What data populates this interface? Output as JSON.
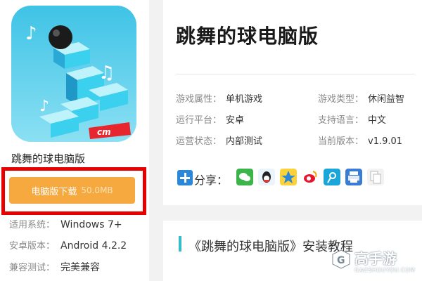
{
  "app": {
    "name": "跳舞的球电脑版",
    "icon_label": "dancing-ball-app-icon",
    "publisher_badge": "cm"
  },
  "download": {
    "label": "电脑版下载",
    "size": "50.0MB"
  },
  "specs": [
    {
      "label": "适用系统：",
      "value": "Windows 7+"
    },
    {
      "label": "安卓版本：",
      "value": "Android 4.2.2"
    },
    {
      "label": "兼容测试：",
      "value": "完美兼容"
    }
  ],
  "header": {
    "title": "跳舞的球电脑版"
  },
  "info": {
    "attr_label": "游戏属性：",
    "attr_value": "单机游戏",
    "type_label": "游戏类型：",
    "type_value": "休闲益智",
    "platform_label": "运行平台：",
    "platform_value": "安卓",
    "lang_label": "支持语言：",
    "lang_value": "中文",
    "status_label": "运营状态：",
    "status_value": "内部测试",
    "version_label": "当前版本：",
    "version_value": "v1.9.01"
  },
  "share": {
    "label": "分享：",
    "icons": [
      "wechat-icon",
      "qq-icon",
      "qzone-icon",
      "weibo-icon",
      "tencent-weibo-icon",
      "print-icon",
      "copy-icon"
    ]
  },
  "section": {
    "title": "《跳舞的球电脑版》安装教程"
  },
  "watermark": {
    "main": "高手游",
    "sub": "GAOSHOUYOU.COM"
  },
  "colors": {
    "download_button": "#f5a93e",
    "highlight_frame": "#e60000",
    "accent": "#36b9c9",
    "share_plus": "#2b87d7"
  }
}
